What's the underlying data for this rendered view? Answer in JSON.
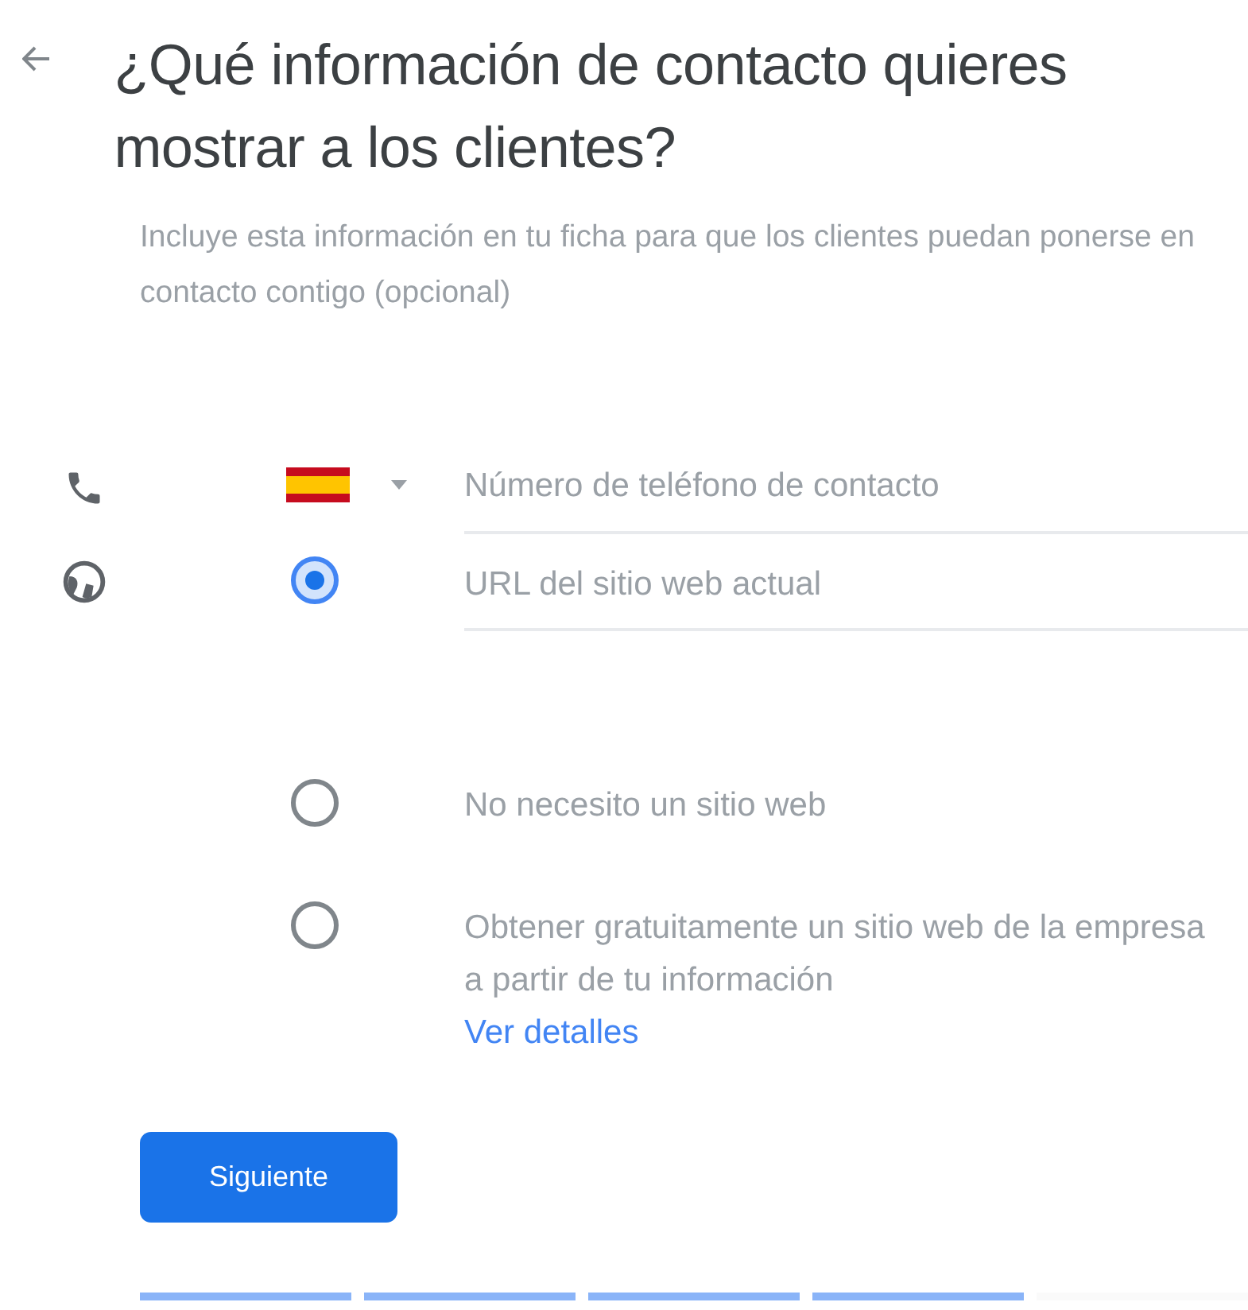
{
  "title": "¿Qué información de contacto quieres mostrar a los clientes?",
  "subtitle": "Incluye esta información en tu ficha para que los clientes puedan ponerse en contacto contigo (opcional)",
  "phone": {
    "placeholder": "Número de teléfono de contacto"
  },
  "website_options": [
    {
      "kind": "field",
      "selected": true,
      "placeholder": "URL del sitio web actual"
    },
    {
      "kind": "text",
      "selected": false,
      "label": "No necesito un sitio web"
    },
    {
      "kind": "text",
      "selected": false,
      "label": "Obtener gratuitamente un sitio web de la empresa a partir de tu información",
      "link": "Ver detalles"
    }
  ],
  "button": "Siguiente",
  "progress": [
    {
      "done": true
    },
    {
      "done": true
    },
    {
      "done": true
    },
    {
      "done": true
    },
    {
      "done": false
    }
  ]
}
